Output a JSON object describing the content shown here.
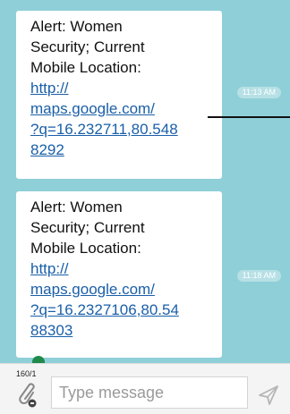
{
  "conversation": {
    "messages": [
      {
        "text": "Alert: Women\nSecurity; Current\nMobile Location:",
        "link": "http://\nmaps.google.com/\n?q=16.232711,80.548\n8292",
        "time": "11:13 AM"
      },
      {
        "text": "Alert: Women\nSecurity; Current\nMobile Location:",
        "link": "http://\nmaps.google.com/\n?q=16.2327106,80.54\n88303",
        "time": "11:18 AM"
      }
    ]
  },
  "composer": {
    "char_counter": "160/1",
    "placeholder": "Type message",
    "attach_icon": "paperclip-icon",
    "send_icon": "send-icon"
  },
  "colors": {
    "chat_background": "#8fcfd8",
    "bubble": "#ffffff",
    "link": "#1a5fa8",
    "composer_background": "#f4f4f4"
  }
}
